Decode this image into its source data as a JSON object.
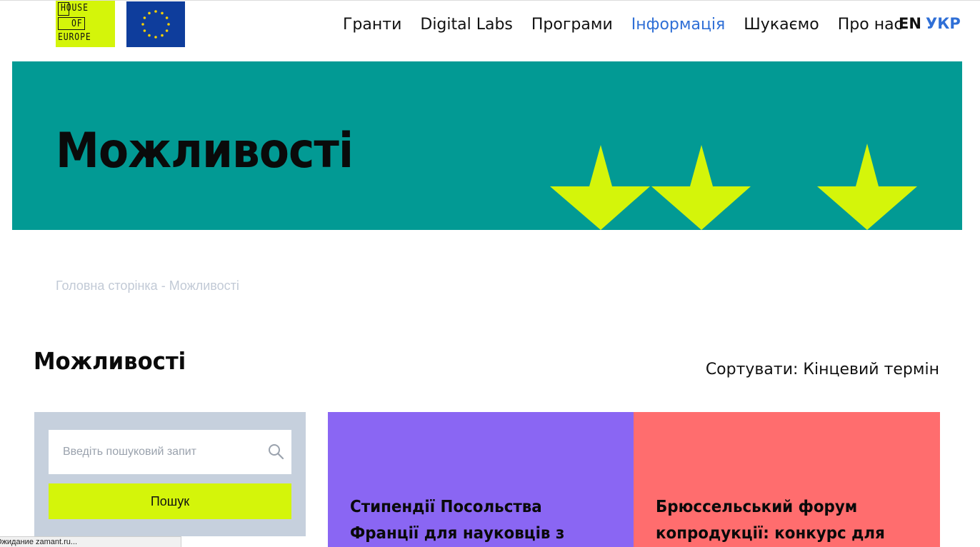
{
  "header": {
    "logo_lines": [
      "HOUSE",
      "OF",
      "EUROPE"
    ],
    "nav": [
      {
        "label": "Гранти",
        "active": false
      },
      {
        "label": "Digital Labs",
        "active": false
      },
      {
        "label": "Програми",
        "active": false
      },
      {
        "label": "Інформація",
        "active": true
      },
      {
        "label": "Шукаємо",
        "active": false
      },
      {
        "label": "Про нас",
        "active": false
      }
    ],
    "lang_en": "EN",
    "lang_ukr": "УКР"
  },
  "hero": {
    "title": "Можливості"
  },
  "breadcrumb": {
    "home": "Головна сторінка",
    "separator": " - ",
    "current": "Можливості"
  },
  "section": {
    "title": "Можливості",
    "sort_label": "Сортувати: Кінцевий термін"
  },
  "search": {
    "placeholder": "Введіть пошуковий запит",
    "value": "",
    "button_label": "Пошук"
  },
  "cards": [
    {
      "title": "Стипендії Посольства Франції для науковців з досвідом"
    },
    {
      "title": "Брюссельський форум копродукції: конкурс для"
    }
  ],
  "status_bar": {
    "text": "Ожидание zamant.ru..."
  },
  "colors": {
    "accent_lime": "#d4f50a",
    "hero_teal": "#029a94",
    "eu_blue": "#0e3d9c",
    "link_blue": "#2f6fd6",
    "card_purple": "#8a66f3",
    "card_coral": "#ff6d6e",
    "panel_grey": "#c6d0dd"
  },
  "icons": {
    "search": "search-icon",
    "eu_stars": "eu-stars-icon"
  }
}
